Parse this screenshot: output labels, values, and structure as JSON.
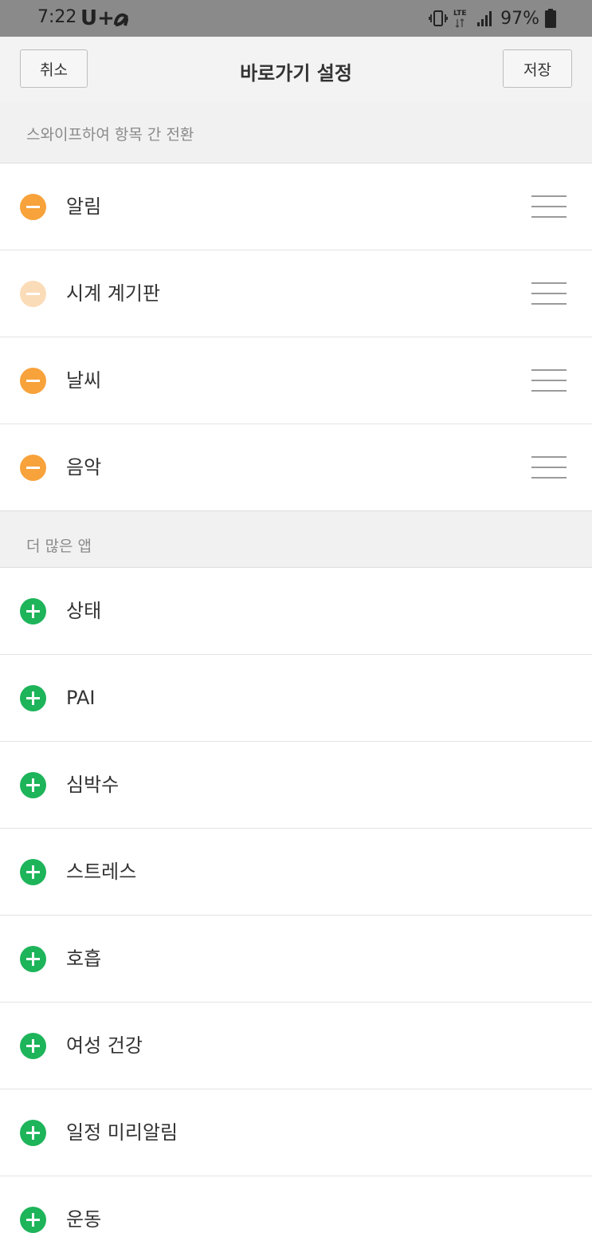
{
  "status_bar": {
    "time": "7:22",
    "carrier": "U+",
    "network": "LTE",
    "battery": "97%"
  },
  "header": {
    "cancel_label": "취소",
    "title": "바로가기 설정",
    "save_label": "저장"
  },
  "active_section": {
    "label": "스와이프하여 항목 간 전환",
    "items": [
      {
        "label": "알림",
        "state": "enabled"
      },
      {
        "label": "시계 계기판",
        "state": "disabled"
      },
      {
        "label": "날씨",
        "state": "enabled"
      },
      {
        "label": "음악",
        "state": "enabled"
      }
    ]
  },
  "more_section": {
    "label": "더 많은 앱",
    "items": [
      {
        "label": "상태"
      },
      {
        "label": "PAI"
      },
      {
        "label": "심박수"
      },
      {
        "label": "스트레스"
      },
      {
        "label": "호흡"
      },
      {
        "label": "여성 건강"
      },
      {
        "label": "일정 미리알림"
      },
      {
        "label": "운동"
      }
    ]
  },
  "colors": {
    "remove": "#f7a23a",
    "remove_disabled": "#fbdcb8",
    "add": "#1db45a"
  },
  "icons": {
    "remove": "minus-circle-icon",
    "add": "plus-circle-icon",
    "handle": "drag-handle-icon"
  }
}
